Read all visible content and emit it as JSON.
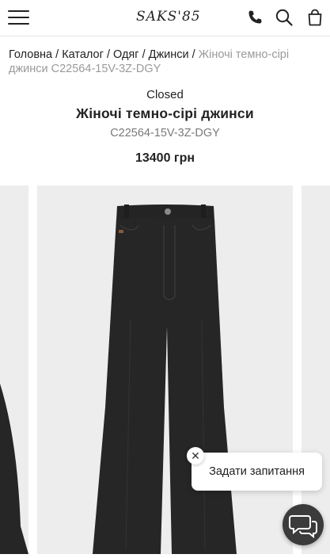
{
  "header": {
    "logo": "SAKS'85",
    "icons": [
      "menu-icon",
      "phone-icon",
      "search-icon",
      "bag-icon"
    ]
  },
  "breadcrumb": {
    "items": [
      "Головна",
      "Каталог",
      "Одяг",
      "Джинси"
    ],
    "separator": "/",
    "current": "Жіночі темно-сірі джинси C22564-15V-3Z-DGY"
  },
  "product": {
    "brand": "Closed",
    "title": "Жіночі темно-сірі джинси",
    "sku": "C22564-15V-3Z-DGY",
    "price": "13400 грн"
  },
  "widget": {
    "ask_label": "Задати запитання",
    "close_glyph": "✕"
  },
  "colors": {
    "denim": "#262626",
    "background_gray": "#ededed"
  }
}
